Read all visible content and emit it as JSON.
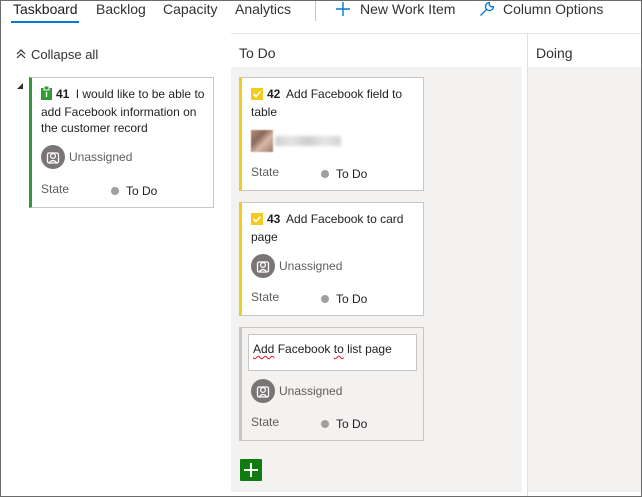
{
  "nav": {
    "tabs": [
      {
        "label": "Taskboard",
        "active": true
      },
      {
        "label": "Backlog",
        "active": false
      },
      {
        "label": "Capacity",
        "active": false
      },
      {
        "label": "Analytics",
        "active": false
      }
    ],
    "new_work_item": "New Work Item",
    "column_options": "Column Options"
  },
  "board": {
    "collapse_all": "Collapse all",
    "columns": [
      {
        "label": "To Do"
      },
      {
        "label": "Doing"
      }
    ]
  },
  "parent_card": {
    "id": "41",
    "title": "I would like to be able to add Facebook information on the customer record",
    "assignee": "Unassigned",
    "state_label": "State",
    "state": "To Do",
    "icon": "backlog-item-icon"
  },
  "tasks": [
    {
      "id": "42",
      "title": "Add Facebook field to table",
      "assignee_blurred": true,
      "state_label": "State",
      "state": "To Do",
      "icon": "task-icon"
    },
    {
      "id": "43",
      "title": "Add Facebook to card page",
      "assignee": "Unassigned",
      "state_label": "State",
      "state": "To Do",
      "icon": "task-icon"
    }
  ],
  "new_task": {
    "value_part1": "Add",
    "value_part2": " Facebook ",
    "value_part3": "to",
    "value_part4": " list page",
    "assignee": "Unassigned",
    "state_label": "State",
    "state": "To Do"
  },
  "colors": {
    "accent": "#0078d4",
    "pbi_green": "#339933",
    "task_yellow": "#f2cb1d",
    "add_green": "#107c10"
  }
}
